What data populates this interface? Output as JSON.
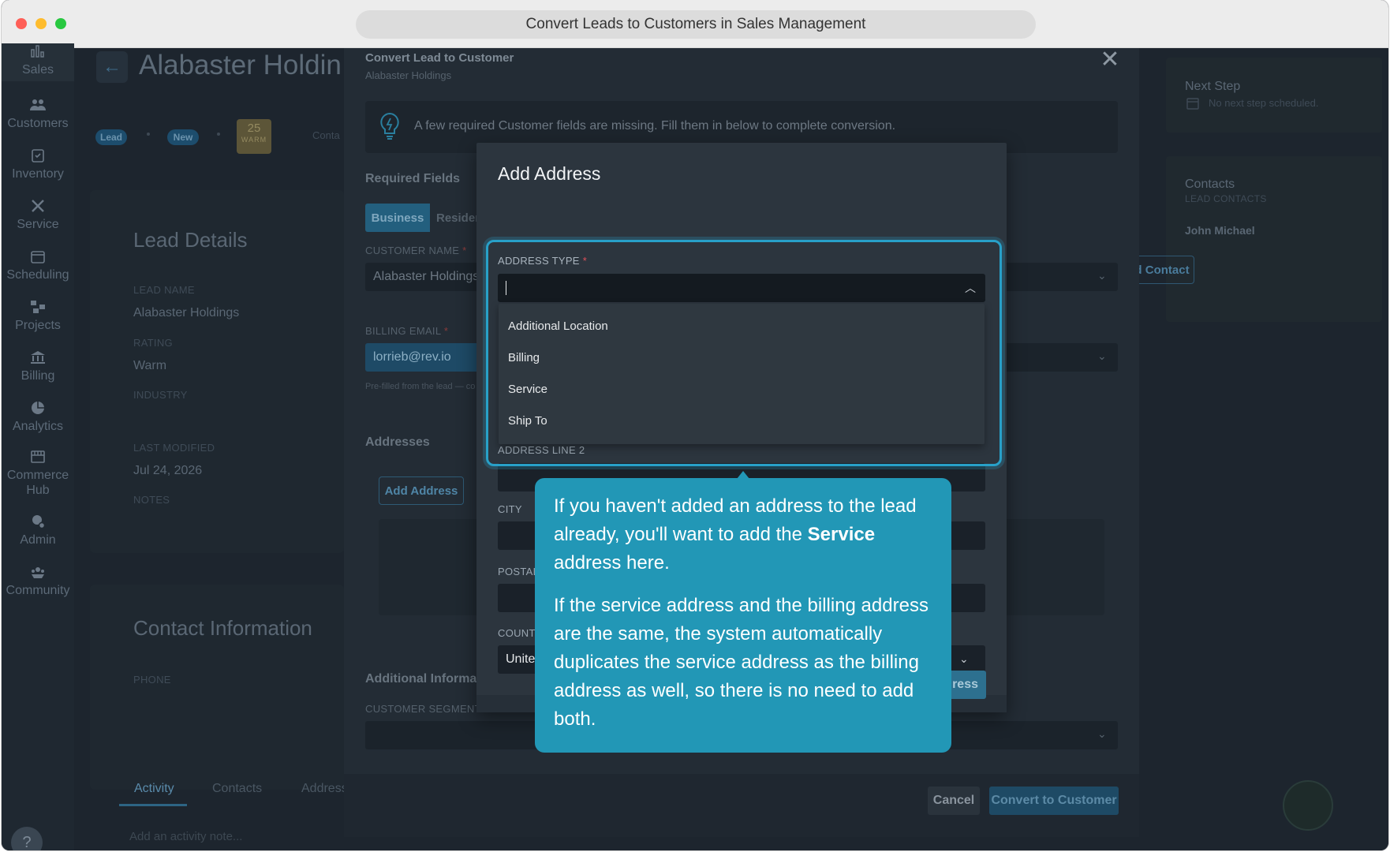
{
  "window": {
    "title": "Convert Leads to Customers in Sales Management"
  },
  "sidebar": {
    "items": [
      {
        "label": "Sales",
        "icon": "chart-icon"
      },
      {
        "label": "Customers",
        "icon": "users-icon"
      },
      {
        "label": "Inventory",
        "icon": "clipboard-icon"
      },
      {
        "label": "Service",
        "icon": "tools-icon"
      },
      {
        "label": "Scheduling",
        "icon": "calendar-icon"
      },
      {
        "label": "Projects",
        "icon": "projects-icon"
      },
      {
        "label": "Billing",
        "icon": "bank-icon"
      },
      {
        "label": "Analytics",
        "icon": "pie-icon"
      },
      {
        "label": "Commerce Hub",
        "icon": "store-icon"
      },
      {
        "label": "Admin",
        "icon": "admin-icon"
      },
      {
        "label": "Community",
        "icon": "community-icon"
      }
    ],
    "help": "?"
  },
  "background": {
    "back_arrow": "←",
    "page_title": "Alabaster Holdin",
    "pills": [
      "Lead",
      "New"
    ],
    "score": {
      "value": "25",
      "label": "WARM"
    },
    "contact_stub": "Conta",
    "lead_details": {
      "heading": "Lead Details",
      "lead_name_label": "LEAD NAME",
      "lead_name": "Alabaster Holdings",
      "rating_label": "RATING",
      "rating": "Warm",
      "industry_label": "INDUSTRY",
      "last_modified_label": "LAST MODIFIED",
      "last_modified": "Jul 24, 2026",
      "notes_label": "NOTES"
    },
    "contact_info": {
      "heading": "Contact Information",
      "phone_label": "PHONE"
    },
    "tabs": [
      "Activity",
      "Contacts",
      "Address"
    ],
    "activity_placeholder": "Add an activity note...",
    "next_step": {
      "title": "Next Step",
      "empty": "No next step scheduled."
    },
    "contacts": {
      "title": "Contacts",
      "subtitle": "LEAD CONTACTS",
      "name": "John Michael",
      "add_button": "Add Contact"
    }
  },
  "convert_modal": {
    "title": "Convert Lead to Customer",
    "subtitle": "Alabaster Holdings",
    "close": "✕",
    "banner": "A few required Customer fields are missing. Fill them in below to complete conversion.",
    "required_heading": "Required Fields",
    "segments": [
      "Business",
      "Residen"
    ],
    "customer_name_label": "CUSTOMER NAME",
    "customer_name": "Alabaster Holdings",
    "billing_email_label": "BILLING EMAIL",
    "billing_email": "lorrieb@rev.io",
    "prefill_hint": "Pre-filled from the lead — co",
    "addresses_heading": "Addresses",
    "add_address_button": "Add Address",
    "additional_heading": "Additional Informati",
    "customer_segment_label": "CUSTOMER SEGMENT",
    "cancel": "Cancel",
    "convert": "Convert to Customer",
    "required_mark": "*"
  },
  "address_modal": {
    "title": "Add Address",
    "address_type_label": "ADDRESS TYPE",
    "required_mark": "*",
    "options": [
      "Additional Location",
      "Billing",
      "Service",
      "Ship To"
    ],
    "line2_label": "ADDRESS LINE 2",
    "city_label": "CITY",
    "postal_label": "POSTAL",
    "country_label": "COUNTR",
    "country_value": "Unite",
    "save_button": "dress"
  },
  "tooltip": {
    "p1_before": "If you haven't added an address to the lead already, you'll want to add the ",
    "p1_bold": "Service",
    "p1_after": " address here.",
    "p2": "If the service address and the billing address are the same, the system automatically duplicates the service address as the billing address as well, so there is no need to add both."
  },
  "colors": {
    "accent": "#2297b6",
    "focus": "#28a0c8",
    "required": "#e0505a"
  }
}
